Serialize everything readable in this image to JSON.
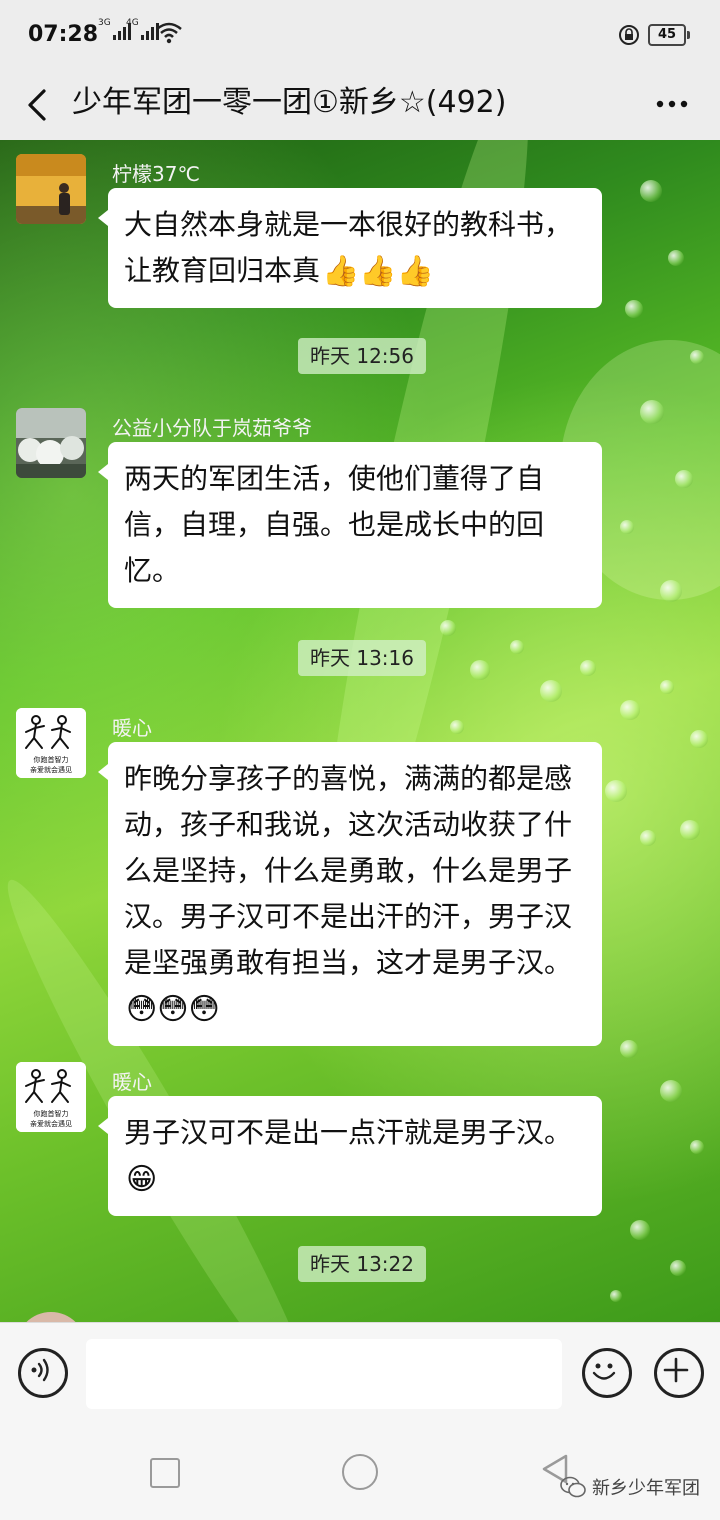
{
  "status_bar": {
    "time": "07:28",
    "network1": "3G",
    "network2": "4G",
    "battery": "45"
  },
  "header": {
    "title": "少年军团一零一团①新乡☆(492)"
  },
  "messages": [
    {
      "sender": "柠檬37℃",
      "text": "大自然本身就是一本很好的教科书，让教育回归本真",
      "emoji": "👍👍👍"
    },
    {
      "timestamp": "昨天 12:56"
    },
    {
      "sender": "公益小分队于岚茹爷爷",
      "text": "两天的军团生活，使他们董得了自信，自理，自强。也是成长中的回忆。"
    },
    {
      "timestamp": "昨天 13:16"
    },
    {
      "sender": "暖心",
      "text": "昨晚分享孩子的喜悦，满满的都是感动，孩子和我说，这次活动收获了什么是坚持，什么是勇敢，什么是男子汉。男子汉可不是出汗的汗，男子汉是坚强勇敢有担当，这才是男子汉。",
      "emoji": "😳😳😳"
    },
    {
      "sender": "暖心",
      "text": "男子汉可不是出一点汗就是男子汉。",
      "emoji": "😁"
    },
    {
      "timestamp": "昨天 13:22"
    }
  ],
  "avatar_caption": "你跑首智力 亲爱就会遇见",
  "input_bar": {
    "placeholder": ""
  },
  "watermark": "新乡少年军团",
  "icons": {
    "back": "chevron-left-icon",
    "more": "more-horizontal-icon",
    "voice": "voice-icon",
    "emoji": "smiley-icon",
    "plus": "plus-circle-icon"
  }
}
